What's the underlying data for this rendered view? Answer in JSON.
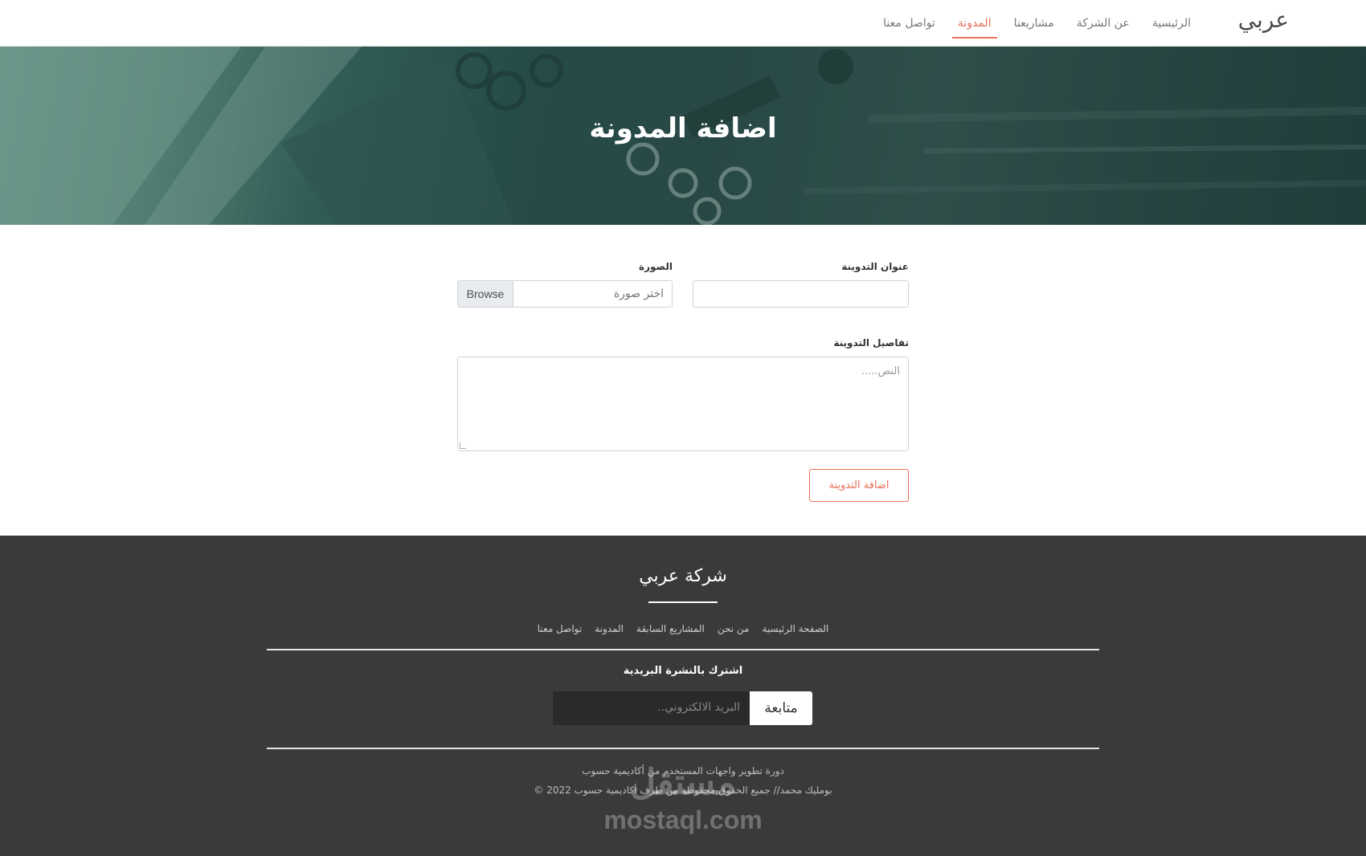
{
  "navbar": {
    "brand": "عربي",
    "links": [
      {
        "label": "الرئيسية",
        "active": false
      },
      {
        "label": "عن الشركة",
        "active": false
      },
      {
        "label": "مشاريعنا",
        "active": false
      },
      {
        "label": "المدونة",
        "active": true
      },
      {
        "label": "تواصل معنا",
        "active": false
      }
    ],
    "accent_color": "#e8715a"
  },
  "hero": {
    "title": "اضافة المدونة"
  },
  "form": {
    "title_label": "عنوان التدوينة",
    "title_value": "",
    "image_label": "الصورة",
    "image_placeholder": "اختر صورة",
    "browse_label": "Browse",
    "details_label": "تفاصيل التدوينة",
    "details_placeholder": "النص.....",
    "submit_label": "اضافة التدوينة"
  },
  "footer": {
    "title": "شركة عربي",
    "links": [
      "الصفحة الرئيسية",
      "من نحن",
      "المشاريع السابقة",
      "المدونة",
      "تواصل معنا"
    ],
    "newsletter_title": "اشترك بالنشرة البريدية",
    "email_placeholder": "البريد الالكتروني..",
    "subscribe_label": "متابعة",
    "credit_line1": "دورة تطوير واجهات المستخدم من أكاديمية حسوب",
    "credit_line2": "بومليك محمد// جميع الحقوق محفوظة من طرف أكاديمية حسوب 2022 ©",
    "watermark_ar": "مستقل",
    "watermark_en": "mostaql.com"
  }
}
